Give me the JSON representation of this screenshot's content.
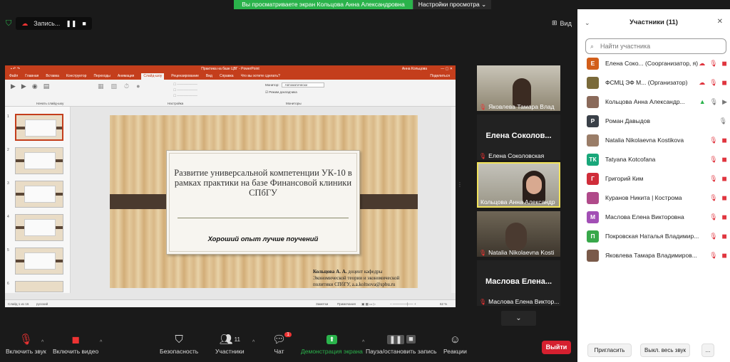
{
  "banner": {
    "message": "Вы просматриваете экран Кольцова Анна Александровна",
    "settings_label": "Настройки просмотра"
  },
  "recording": {
    "label": "Запись..."
  },
  "view": {
    "label": "Вид"
  },
  "ppt": {
    "title": "Практика на базе ЦВГ - PowerPoint",
    "user": "Анна Кольцова",
    "menu": [
      "Файл",
      "Главная",
      "Вставка",
      "Конструктор",
      "Переходы",
      "Анимация",
      "Слайд-шоу",
      "Рецензирование",
      "Вид",
      "Справка",
      "Что вы хотите сделать?"
    ],
    "share": "Поделиться",
    "ribbon_groups": [
      "Начать слайд-шоу",
      "Настройка",
      "Мониторы"
    ],
    "monitor_label": "Монитор:",
    "monitor_value": "Автоматически",
    "presenter_mode": "Режим докладчика",
    "slide_title": "Развитие универсальной компетенции УК-10 в рамках практики на базе Финансовой клиники СПбГУ",
    "slide_subtitle": "Хороший опыт лучше поучений",
    "author_name": "Кольцова А. А.",
    "author_text": "доцент кафедры Экономической теории и экономической политики СПбГУ, a.a.koltsova@spbu.ru",
    "status_slide": "Слайд 1 из 16",
    "status_lang": "русский",
    "status_notes": "Заметки",
    "status_comments": "Примечания",
    "zoom": "62 %",
    "thumb_numbers": [
      "1",
      "2",
      "3",
      "4",
      "5",
      "6"
    ]
  },
  "tiles": [
    {
      "name": "Яковлева Тамара Влад",
      "muted": true,
      "video": true
    },
    {
      "name": "Елена Соколовская",
      "big": "Елена  Соколов...",
      "muted": true,
      "video": false
    },
    {
      "name": "Кольцова Анна Александр",
      "muted": false,
      "video": true,
      "selected": true
    },
    {
      "name": "Natalia Nikolaevna Kosti",
      "muted": true,
      "video": true
    },
    {
      "name": "Маслова Елена Виктор...",
      "big": "Маслова  Елена...",
      "muted": true,
      "video": false
    }
  ],
  "toolbar": {
    "unmute": "Включить звук",
    "start_video": "Включить видео",
    "security": "Безопасность",
    "participants": "Участники",
    "participants_count": "11",
    "chat": "Чат",
    "chat_badge": "1",
    "share": "Демонстрация экрана",
    "pause_rec": "Пауза/остановить запись",
    "reactions": "Реакции",
    "leave": "Выйти"
  },
  "panel": {
    "title": "Участники (11)",
    "search_placeholder": "Найти участника",
    "participants": [
      {
        "name": "Елена Соко... (Соорганизатор, я)",
        "initial": "Е",
        "color": "#d25e1a"
      },
      {
        "name": "ФСМЦ ЭФ М... (Организатор)",
        "initial": "",
        "color": "#7a6a3a"
      },
      {
        "name": "Кольцова Анна Александр...",
        "initial": "",
        "color": "#8a6a5a"
      },
      {
        "name": "Роман Давыдов",
        "initial": "Р",
        "color": "#3a4048"
      },
      {
        "name": "Natalia Nikolaevna Kostikova",
        "initial": "",
        "color": "#9a7d68"
      },
      {
        "name": "Tatyana Kotcofana",
        "initial": "ТК",
        "color": "#19a77a"
      },
      {
        "name": "Григорий Ким",
        "initial": "Г",
        "color": "#d02d3a"
      },
      {
        "name": "Куранов Никита | Кострома",
        "initial": "",
        "color": "#b04a8a"
      },
      {
        "name": "Маслова Елена Викторовна",
        "initial": "М",
        "color": "#a24fb5"
      },
      {
        "name": "Покровская Наталья Владимир...",
        "initial": "П",
        "color": "#38a84a"
      },
      {
        "name": "Яковлева Тамара Владимиров...",
        "initial": "",
        "color": "#7a5a4a"
      }
    ],
    "invite": "Пригласить",
    "mute_all": "Выкл. весь звук",
    "more": "..."
  }
}
